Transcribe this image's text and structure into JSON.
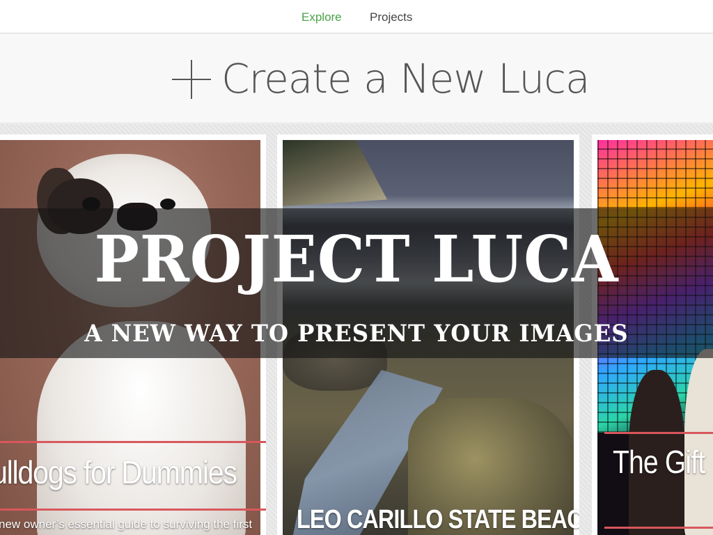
{
  "nav": {
    "tabs": [
      {
        "label": "Explore",
        "active": true
      },
      {
        "label": "Projects",
        "active": false
      }
    ],
    "active_color": "#4aa248"
  },
  "create": {
    "label": "Create a New Luca",
    "icon": "plus-icon"
  },
  "cards": [
    {
      "title": "ulldogs for Dummies",
      "description": "new owner’s essential guide to surviving the first",
      "image": "bulldog-photo"
    },
    {
      "title": "LEO CARILLO STATE BEACH",
      "image": "beach-photo"
    },
    {
      "title": "The Gift",
      "image": "lights-photo"
    }
  ],
  "accent_color": "#d8575c",
  "hero": {
    "title": "PROJECT LUCA",
    "subtitle": "A NEW WAY TO PRESENT YOUR IMAGES"
  }
}
